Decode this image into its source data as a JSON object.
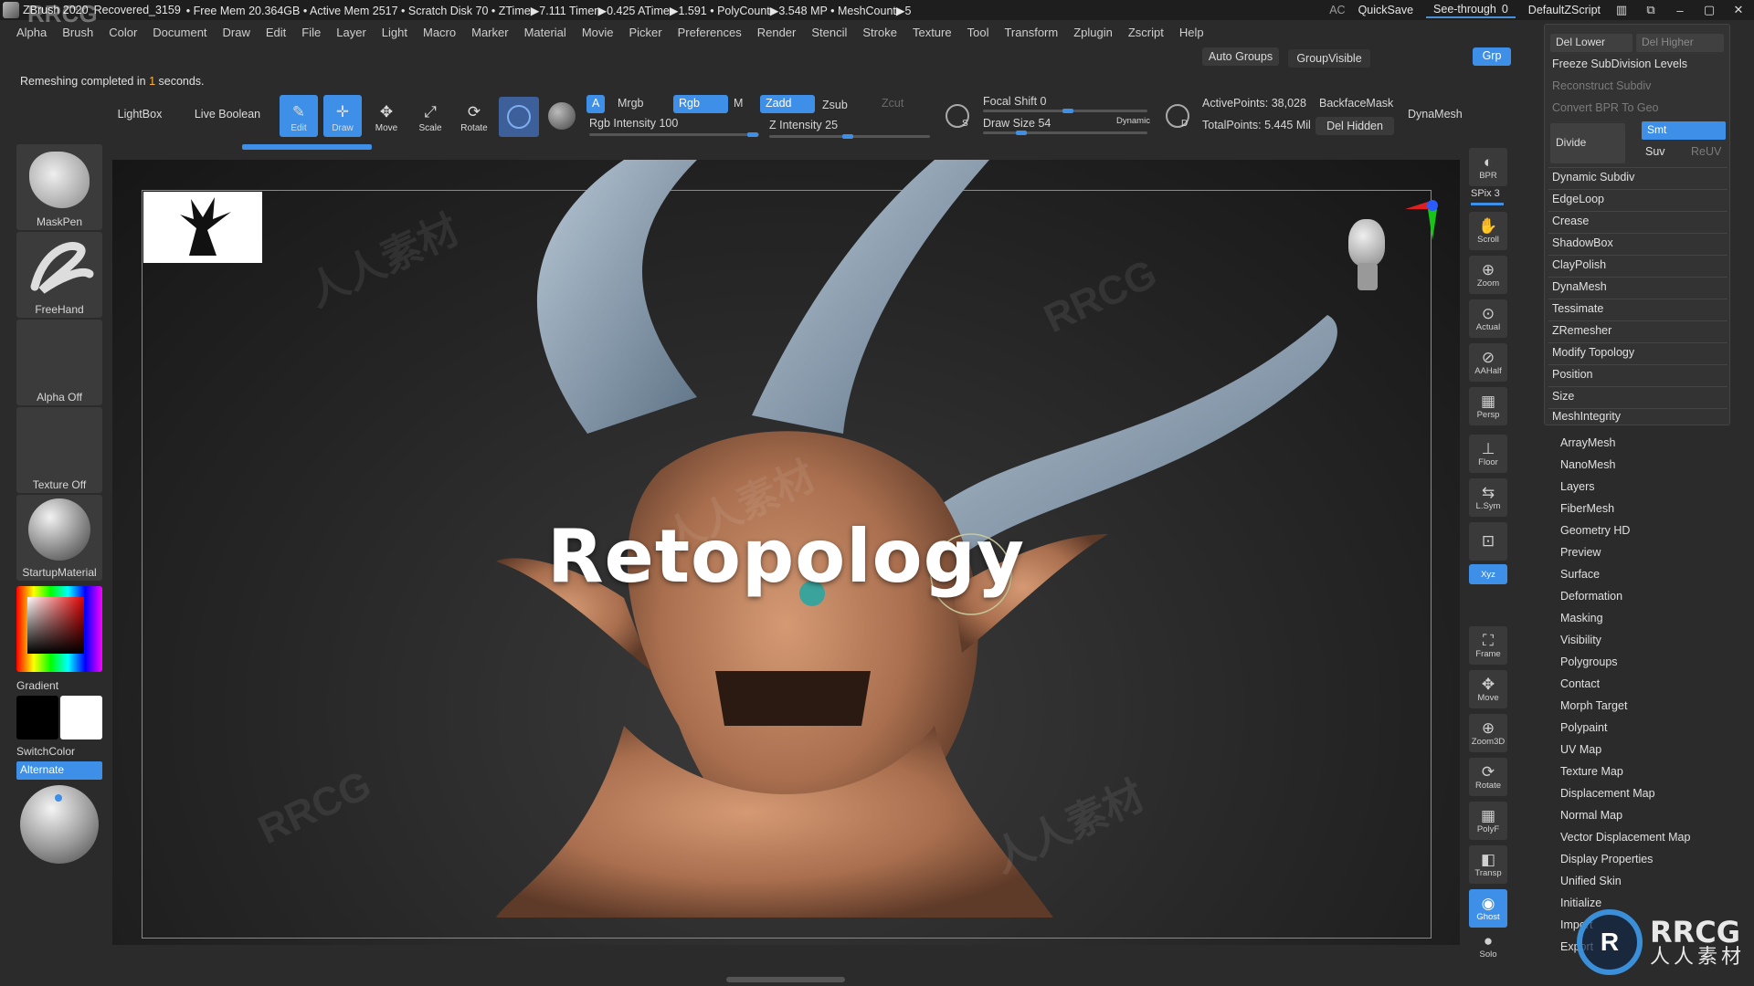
{
  "titlebar": {
    "app": "ZBrush 2020",
    "project": "Recovered_3159",
    "status": "• Free Mem 20.364GB • Active Mem 2517 • Scratch Disk 70 • ZTime▶7.111 Timer▶0.425 ATime▶1.591 • PolyCount▶3.548 MP • MeshCount▶5",
    "ac": "AC",
    "quicksave": "QuickSave",
    "seethrough": "See-through",
    "seethrough_value": "0",
    "script": "DefaultZScript"
  },
  "menu": [
    "Alpha",
    "Brush",
    "Color",
    "Document",
    "Draw",
    "Edit",
    "File",
    "Layer",
    "Light",
    "Macro",
    "Marker",
    "Material",
    "Movie",
    "Picker",
    "Preferences",
    "Render",
    "Stencil",
    "Stroke",
    "Texture",
    "Tool",
    "Transform",
    "Zplugin",
    "Zscript",
    "Help"
  ],
  "status_message": {
    "prefix": "Remeshing completed in",
    "value": "1",
    "suffix": "seconds."
  },
  "toolbar": {
    "lightbox": "LightBox",
    "live_boolean": "Live Boolean",
    "edit": "Edit",
    "draw": "Draw",
    "move": "Move",
    "scale": "Scale",
    "rotate": "Rotate",
    "a": "A",
    "mrgb": "Mrgb",
    "rgb": "Rgb",
    "m": "M",
    "rgb_intensity_label": "Rgb Intensity",
    "rgb_intensity_value": "100",
    "zadd": "Zadd",
    "zsub": "Zsub",
    "zcut": "Zcut",
    "z_intensity_label": "Z Intensity",
    "z_intensity_value": "25",
    "focal_shift_label": "Focal Shift",
    "focal_shift_value": "0",
    "draw_size_label": "Draw Size",
    "draw_size_value": "54",
    "dynamic": "Dynamic",
    "active_points": "ActivePoints: 38,028",
    "total_points": "TotalPoints: 5.445 Mil",
    "backface_mask": "BackfaceMask",
    "del_hidden": "Del Hidden",
    "dynamesh": "DynaMesh",
    "auto_groups": "Auto Groups",
    "group_visible": "GroupVisible",
    "grp": "Grp",
    "s": "S",
    "d": "D"
  },
  "left_shelf": [
    {
      "label": "MaskPen"
    },
    {
      "label": "FreeHand"
    },
    {
      "label": "Alpha Off"
    },
    {
      "label": "Texture Off"
    },
    {
      "label": "StartupMaterial"
    }
  ],
  "left_color": {
    "gradient_label": "Gradient",
    "switch_label": "SwitchColor",
    "alternate_label": "Alternate"
  },
  "viewport": {
    "overlay_text": "Retopology"
  },
  "right_shelf": [
    {
      "label": "BPR",
      "glyph": "◐"
    },
    {
      "label": "SPix 3",
      "glyph": ""
    },
    {
      "label": "Scroll",
      "glyph": "✋"
    },
    {
      "label": "Zoom",
      "glyph": "⊕"
    },
    {
      "label": "Actual",
      "glyph": "⊙"
    },
    {
      "label": "AAHalf",
      "glyph": "⊘"
    },
    {
      "label": "Persp",
      "glyph": "▦"
    },
    {
      "label": "Floor",
      "glyph": "⊥"
    },
    {
      "label": "L.Sym",
      "glyph": "⇆"
    },
    {
      "label": "",
      "glyph": "🔒"
    },
    {
      "label": "Xyz",
      "glyph": ""
    },
    {
      "label": "Frame",
      "glyph": "⛶"
    },
    {
      "label": "Move",
      "glyph": "✥"
    },
    {
      "label": "Zoom3D",
      "glyph": "⊕"
    },
    {
      "label": "Rotate",
      "glyph": "⟳"
    },
    {
      "label": "PolyF",
      "glyph": "▦"
    },
    {
      "label": "Transp",
      "glyph": "◧"
    },
    {
      "label": "Ghost",
      "glyph": "◉"
    },
    {
      "label": "Solo",
      "glyph": "●"
    }
  ],
  "palette": {
    "del_lower": "Del Lower",
    "del_higher": "Del Higher",
    "freeze": "Freeze SubDivision Levels",
    "reconstruct": "Reconstruct Subdiv",
    "convert": "Convert BPR To Geo",
    "divide": "Divide",
    "smt": "Smt",
    "suv": "Suv",
    "reuv": "ReUV",
    "items": [
      "Dynamic Subdiv",
      "EdgeLoop",
      "Crease",
      "ShadowBox",
      "ClayPolish",
      "DynaMesh",
      "Tessimate",
      "ZRemesher",
      "Modify Topology",
      "Position",
      "Size",
      "MeshIntegrity"
    ]
  },
  "tool_list": [
    "ArrayMesh",
    "NanoMesh",
    "Layers",
    "FiberMesh",
    "Geometry HD",
    "Preview",
    "Surface",
    "Deformation",
    "Masking",
    "Visibility",
    "Polygroups",
    "Contact",
    "Morph Target",
    "Polypaint",
    "UV Map",
    "Texture Map",
    "Displacement Map",
    "Normal Map",
    "Vector Displacement Map",
    "Display Properties",
    "Unified Skin",
    "Initialize",
    "Import",
    "Export"
  ],
  "watermark": {
    "text": "RRCG",
    "cn": "人人素材",
    "logo_big": "RRCG",
    "logo_small": "人人素材"
  },
  "colors": {
    "accent": "#3d8fe8",
    "bg": "#2b2b2b",
    "skin": "#c48a66",
    "horn": "#8aa0b4"
  }
}
